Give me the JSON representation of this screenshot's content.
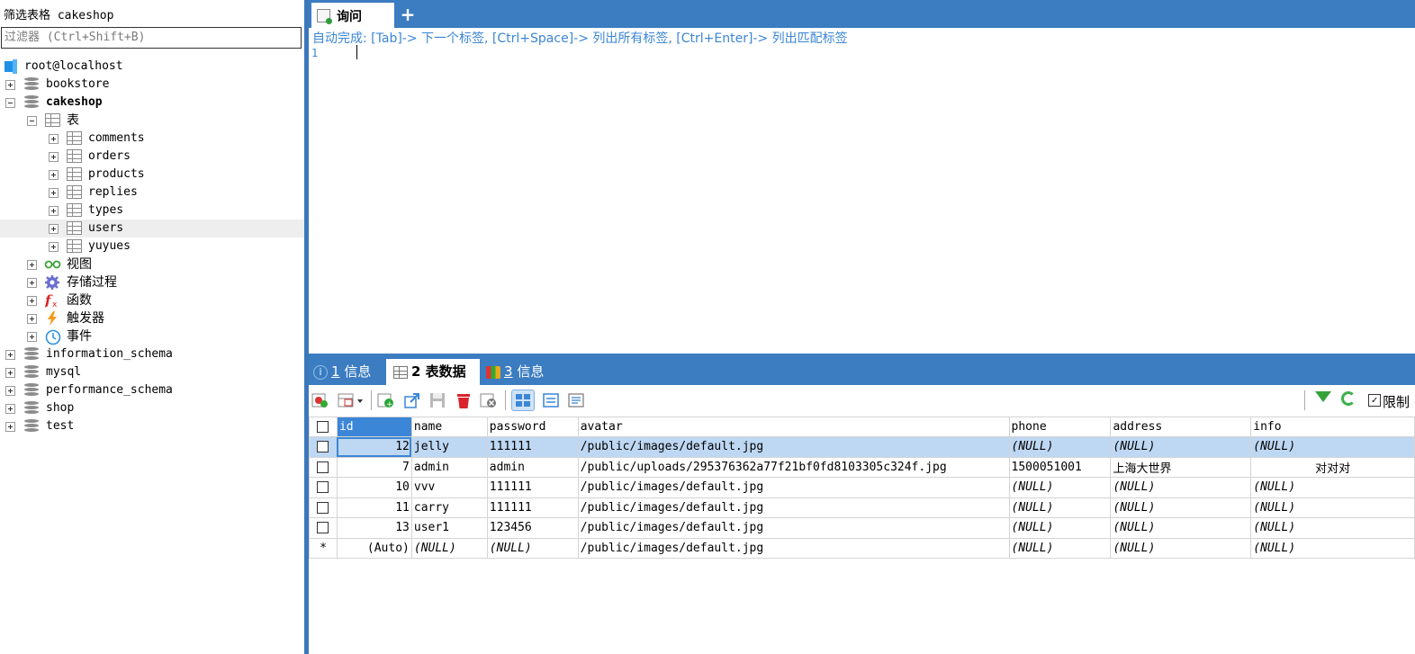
{
  "filter": {
    "title": "筛选表格 cakeshop",
    "placeholder": "过滤器 (Ctrl+Shift+B)"
  },
  "tree": {
    "root": "root@localhost",
    "databases_before": [
      "bookstore"
    ],
    "current_db": "cakeshop",
    "tables_folder": "表",
    "tables": [
      "comments",
      "orders",
      "products",
      "replies",
      "types",
      "users",
      "yuyues"
    ],
    "selected_table": "users",
    "folders": [
      "视图",
      "存储过程",
      "函数",
      "触发器",
      "事件"
    ],
    "databases_after": [
      "information_schema",
      "mysql",
      "performance_schema",
      "shop",
      "test"
    ]
  },
  "query_tab": {
    "label": "询问",
    "add_label": "+"
  },
  "editor": {
    "hint": "自动完成: [Tab]-> 下一个标签, [Ctrl+Space]-> 列出所有标签, [Ctrl+Enter]-> 列出匹配标签",
    "line_number": "1"
  },
  "result_tabs": [
    {
      "num": "1",
      "label": "信息"
    },
    {
      "num": "2",
      "label": "表数据"
    },
    {
      "num": "3",
      "label": "信息"
    }
  ],
  "toolbar": {
    "limit_label": "限制",
    "limit_checked": "✓"
  },
  "grid": {
    "columns": [
      "id",
      "name",
      "password",
      "avatar",
      "phone",
      "address",
      "info"
    ],
    "rows": [
      [
        "12",
        "jelly",
        "111111",
        "/public/images/default.jpg",
        "(NULL)",
        "(NULL)",
        "(NULL)"
      ],
      [
        "7",
        "admin",
        "admin",
        "/public/uploads/295376362a77f21bf0fd8103305c324f.jpg",
        "1500051001",
        "上海大世界",
        "对对对"
      ],
      [
        "10",
        "vvv",
        "111111",
        "/public/images/default.jpg",
        "(NULL)",
        "(NULL)",
        "(NULL)"
      ],
      [
        "11",
        "carry",
        "111111",
        "/public/images/default.jpg",
        "(NULL)",
        "(NULL)",
        "(NULL)"
      ],
      [
        "13",
        "user1",
        "123456",
        "/public/images/default.jpg",
        "(NULL)",
        "(NULL)",
        "(NULL)"
      ]
    ],
    "new_row": {
      "marker": "*",
      "values": [
        "(Auto)",
        "(NULL)",
        "(NULL)",
        "/public/images/default.jpg",
        "(NULL)",
        "(NULL)",
        "(NULL)"
      ]
    }
  },
  "colors": {
    "accent": "#3c7cc0",
    "hint": "#3b86d6",
    "selected_row": "#bed7f3"
  }
}
